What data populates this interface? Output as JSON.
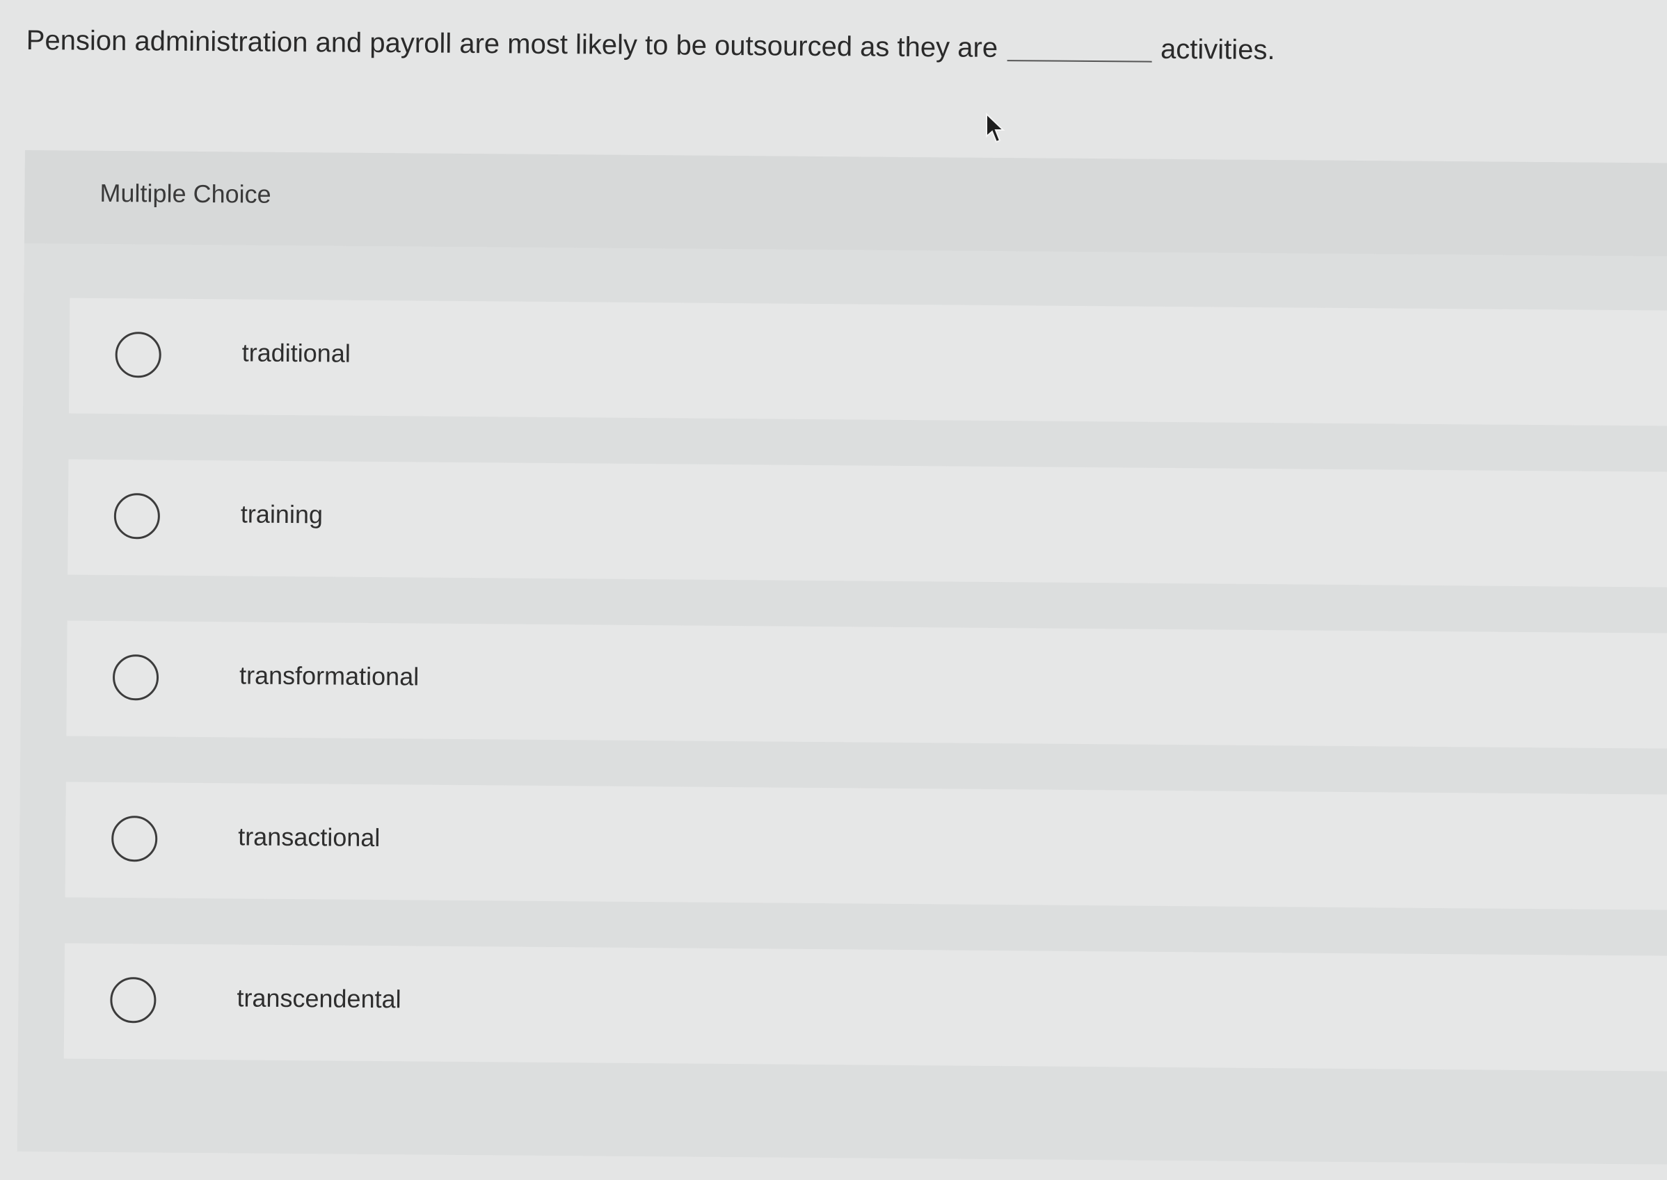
{
  "question": {
    "text_before": "Pension administration and payroll are most likely to be outsourced as they are",
    "text_after": "activities."
  },
  "multiple_choice": {
    "label": "Multiple Choice",
    "options": [
      {
        "label": "traditional"
      },
      {
        "label": "training"
      },
      {
        "label": "transformational"
      },
      {
        "label": "transactional"
      },
      {
        "label": "transcendental"
      }
    ]
  },
  "colors": {
    "background": "#e4e5e5",
    "panel": "#dcdede",
    "option_bg": "#e6e7e7",
    "text": "#2b2b2b"
  },
  "icons": {
    "cursor": "mouse-pointer-icon",
    "radio": "radio-unchecked-icon"
  }
}
